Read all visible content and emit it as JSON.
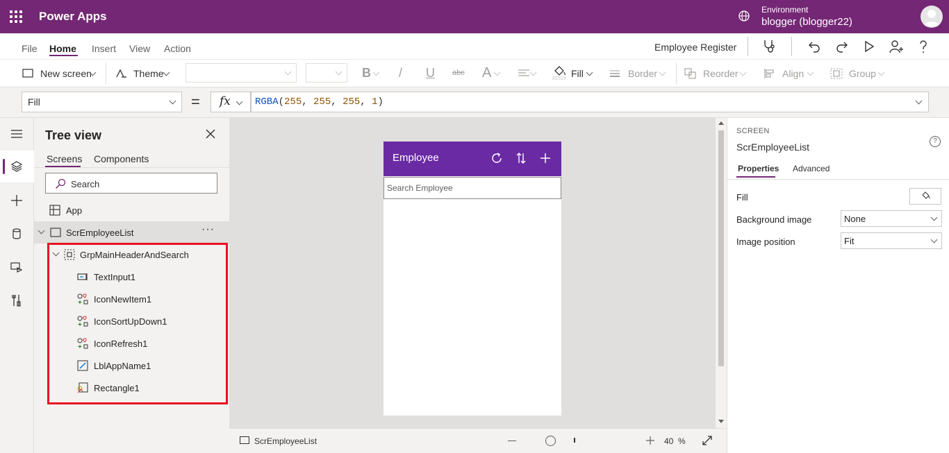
{
  "topbar": {
    "app_title": "Power Apps",
    "environment_label": "Environment",
    "environment_value": "blogger (blogger22)"
  },
  "menu": {
    "items": [
      "File",
      "Home",
      "Insert",
      "View",
      "Action"
    ],
    "active": "Home",
    "app_name": "Employee Register"
  },
  "ribbon": {
    "new_screen": "New screen",
    "theme": "Theme",
    "bold": "B",
    "italic": "/",
    "underline": "U",
    "strike": "abc",
    "font_size_icon": "A",
    "fill": "Fill",
    "border": "Border",
    "reorder": "Reorder",
    "align": "Align",
    "group": "Group"
  },
  "formula": {
    "property": "Fill",
    "equals": "=",
    "fx": "fx",
    "fn": "RGBA",
    "args": [
      "255",
      "255",
      "255",
      "1"
    ]
  },
  "tree": {
    "title": "Tree view",
    "tabs": [
      "Screens",
      "Components"
    ],
    "active_tab": "Screens",
    "search_placeholder": "Search",
    "app_node": "App",
    "screen_node": "ScrEmployeeList",
    "more": "···",
    "group_node": "GrpMainHeaderAndSearch",
    "children": [
      {
        "label": "TextInput1",
        "icon": "text-input-icon"
      },
      {
        "label": "IconNewItem1",
        "icon": "shapes-icon"
      },
      {
        "label": "IconSortUpDown1",
        "icon": "shapes-icon"
      },
      {
        "label": "IconRefresh1",
        "icon": "shapes-icon"
      },
      {
        "label": "LblAppName1",
        "icon": "label-edit-icon"
      },
      {
        "label": "Rectangle1",
        "icon": "rectangle-shape-icon"
      }
    ]
  },
  "canvas": {
    "header_title": "Employee",
    "search_placeholder": "Search Employee",
    "header_color": "#6a2aa3"
  },
  "status": {
    "screen": "ScrEmployeeList",
    "zoom": "40",
    "zoom_unit": "%"
  },
  "props": {
    "kind": "SCREEN",
    "name": "ScrEmployeeList",
    "help": "?",
    "tabs": [
      "Properties",
      "Advanced"
    ],
    "active_tab": "Properties",
    "fill_label": "Fill",
    "bg_image_label": "Background image",
    "bg_image_value": "None",
    "image_position_label": "Image position",
    "image_position_value": "Fit"
  },
  "colors": {
    "brand": "#742774",
    "highlight": "#e81123"
  }
}
